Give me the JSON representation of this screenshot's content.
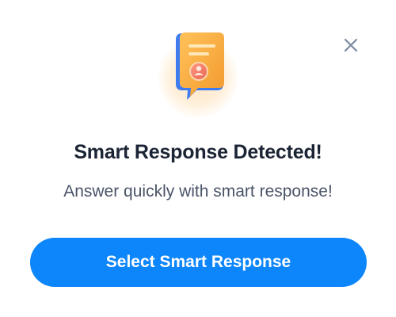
{
  "dialog": {
    "icon": "smart-response-note-icon",
    "title": "Smart Response Detected!",
    "subtitle": "Answer quickly with smart response!",
    "primary_button_label": "Select Smart Response",
    "close_icon": "close-icon"
  },
  "colors": {
    "accent": "#0e86fb",
    "title_text": "#1b2434",
    "subtitle_text": "#4a5468",
    "close_icon": "#7a8aa0",
    "illustration_glow": "#fff1dc",
    "note_orange": "#f5a53a",
    "note_blue": "#3f7cf0",
    "avatar_badge": "#f07a6a"
  }
}
